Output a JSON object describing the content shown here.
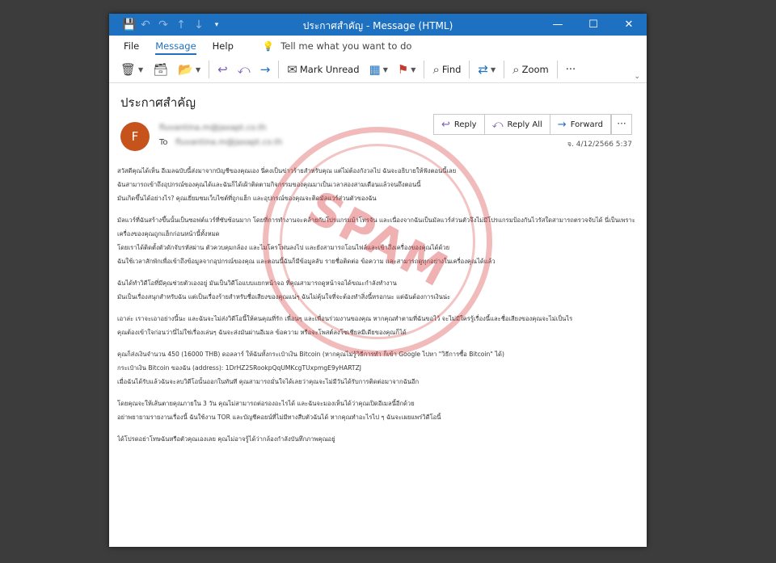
{
  "window": {
    "title": "ประกาศสำคัญ - Message (HTML)",
    "controls": {
      "minimize": "—",
      "restore": "☐",
      "close": "✕"
    }
  },
  "menu": {
    "items": [
      "File",
      "Message",
      "Help"
    ],
    "active": "Message",
    "tell_me": "Tell me what you want to do"
  },
  "ribbon": {
    "mark_unread": "Mark Unread",
    "find": "Find",
    "zoom": "Zoom",
    "more": "···"
  },
  "email": {
    "subject": "ประกาศสำคัญ",
    "avatar_initial": "F",
    "from": "fluvantina.m@jaxapt.co.th",
    "to_label": "To",
    "to": "fluvantina.m@jaxapt.co.th",
    "date": "จ. 4/12/2566 5:37",
    "actions": {
      "reply": "Reply",
      "reply_all": "Reply All",
      "forward": "Forward",
      "more": "···"
    },
    "paragraphs": [
      [
        "สวัสดีคุณได้เห็น อีเมลฉบับนี้ส่งมาจากบัญชีของคุณเอง นี่คงเป็นข่าวร้ายสำหรับคุณ แต่ไม่ต้องกังวลไป ฉันจะอธิบายให้ฟังตอนนี้เลย",
        "ฉันสามารถเข้าถึงอุปกรณ์ของคุณได้และฉันก็ได้เฝ้าติดตามกิจกรรมของคุณมาเป็นเวลาสองสามเดือนแล้วจนถึงตอนนี้",
        "มันเกิดขึ้นได้อย่างไร? คุณเยี่ยมชมเว็บไซต์ที่ถูกแฮ็ก และอุปกรณ์ของคุณจะติดมัลแวร์ส่วนตัวของฉัน"
      ],
      [
        "มัลแวร์ที่ฉันสร้างขึ้นนั้นเป็นซอฟต์แวร์ที่ซับซ้อนมาก โดยที่การทำงานจะคล้ายกับโปรแกรมม้าโทรจัน และเนื่องจากฉันเป็นมัลแวร์ส่วนตัวจึงไม่มีโปรแกรมป้องกันไวรัสใดสามารถตรวจจับได้ นี่เป็นเพราะ",
        "เครื่องของคุณถูกแฮ็กก่อนหน้านี้ทั้งหมด",
        "โดยเราได้ติดตั้งตัวดักจับรหัสผ่าน ตัวควบคุมกล้อง และไมโครโฟนลงไป และยังสามารถโอนไฟล์และเข้าถึงเครื่องของคุณได้ด้วย",
        "ฉันใช้เวลาสักพักเพื่อเข้าถึงข้อมูลจากอุปกรณ์ของคุณ และตอนนี้ฉันก็มีข้อมูลลับ รายชื่อติดต่อ ข้อความ และสามารถดูทุกอย่างในเครื่องคุณได้แล้ว"
      ],
      [
        "ฉันได้ทำวิดีโอที่มีคุณช่วยตัวเองอยู่ มันเป็นวิดีโอแบบแยกหน้าจอ ที่คุณสามารถดูหน้าจอได้ขณะกำลังทำงาน",
        "มันเป็นเรื่องสนุกสำหรับฉัน แต่เป็นเรื่องร้ายสำหรับชื่อเสียงของคุณแน่ๆ ฉันไม่คุ้นใจที่จะต้องทำสิ่งนี้หรอกนะ แต่ฉันต้องการเงินน่ะ"
      ],
      [
        "เอาล่ะ เราจะเอาอย่างนี้นะ และฉันจะไม่ส่งวิดีโอนี้ให้คนคุณที่รัก เพื่อนๆ และเพื่อนร่วมงานของคุณ หากคุณทำตามที่ฉันขอไว้ จะไม่มีใครรู้เรื่องนี้และชื่อเสียงของคุณจะไม่เป็นไร",
        "คุณต้องเข้าใจก่อนว่านี่ไม่ใช่เรื่องเล่นๆ ฉันจะส่งมันผ่านอีเมล ข้อความ หรือจะโพสต์ลงโซเชียลมีเดียของคุณก็ได้"
      ],
      [
        "คุณก็ส่งเงินจำนวน 450 (16000 THB) ดอลลาร์ ให้ฉันทั้งกระเป๋าเงิน Bitcoin (หากคุณไม่รู้วิธีการทำ ก็เข้า Google ไปหา \"วิธีการซื้อ Bitcoin\" ได้)",
        "กระเป๋าเงิน Bitcoin ของฉัน (address): 1DrHZ2SRookpQqUMKcgTUxpmgE9yHARTZJ",
        "เมื่อฉันได้รับแล้วฉันจะลบวิดีโอนั้นออกในทันที คุณสามารถมั่นใจได้เลยว่าคุณจะไม่มีวันได้รับการติดต่อมาจากฉันอีก"
      ],
      [
        "โดยคุณจะให้เส้นตายคุณภายใน 3 วัน คุณไม่สามารถต่อรองอะไรได้ และฉันจะมองเห็นได้ว่าคุณเปิดอีเมลนี้อีกด้วย",
        "อย่าพยายามรายงานเรื่องนี้ ฉันใช้งาน TOR และบัญชีคอยน์ที่ไม่มีทางสืบตัวฉันได้ หากคุณทำอะไรไป ๆ ฉันจะเผยแพร่วิดีโอนี้"
      ],
      [
        "ได้โปรดอย่าโทษฉันหรือตัวคุณเองเลย คุณไม่อาจรู้ได้ว่ากล้องกำลังบันทึกภาพคุณอยู่"
      ]
    ]
  },
  "stamp": {
    "text": "SPAM"
  },
  "colors": {
    "titlebar": "#1e70c1",
    "avatar": "#c6531c",
    "stamp": "#d73c3c"
  }
}
